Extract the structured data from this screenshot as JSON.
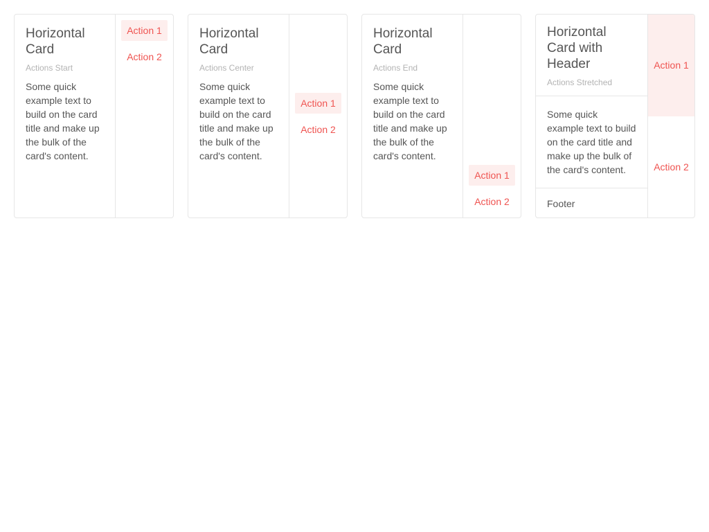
{
  "cards": [
    {
      "title": "Horizontal Card",
      "subtitle": "Actions Start",
      "text": "Some quick example text to build on the card title and make up the bulk of the card's content.",
      "actions": [
        "Action 1",
        "Action 2"
      ]
    },
    {
      "title": "Horizontal Card",
      "subtitle": "Actions Center",
      "text": "Some quick example text to build on the card title and make up the bulk of the card's content.",
      "actions": [
        "Action 1",
        "Action 2"
      ]
    },
    {
      "title": "Horizontal Card",
      "subtitle": "Actions End",
      "text": "Some quick example text to build on the card title and make up the bulk of the card's content.",
      "actions": [
        "Action 1",
        "Action 2"
      ]
    },
    {
      "title": "Horizontal Card with Header",
      "subtitle": "Actions Stretched",
      "text": "Some quick example text to build on the card title and make up the bulk of the card's content.",
      "footer": "Footer",
      "actions": [
        "Action 1",
        "Action 2"
      ]
    }
  ],
  "colors": {
    "accent": "#ef5350",
    "accent_hover_bg": "#fdeeed",
    "border": "#e6e6e6",
    "text": "#555555",
    "subtitle": "#b3b3b3"
  }
}
